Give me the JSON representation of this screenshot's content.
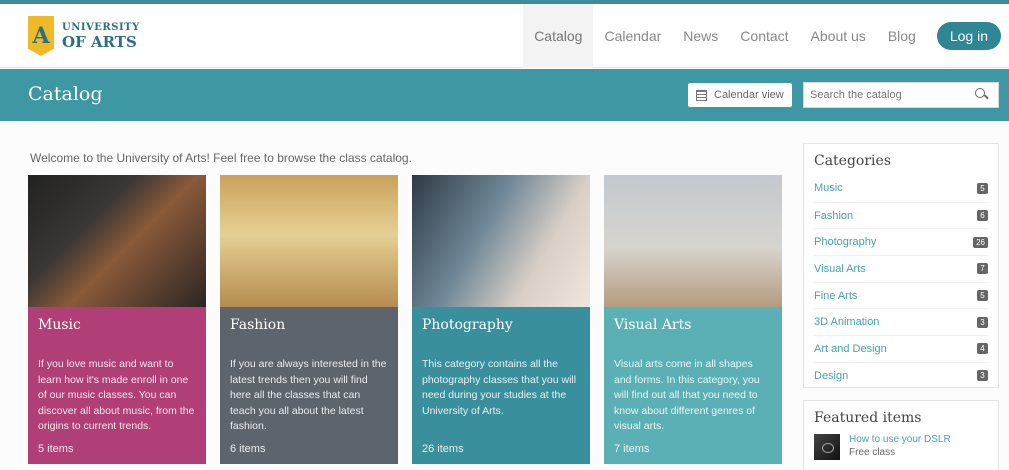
{
  "logo": {
    "letter": "A",
    "line1": "UNIVERSITY",
    "line2": "OF ARTS"
  },
  "nav": {
    "items": [
      "Catalog",
      "Calendar",
      "News",
      "Contact",
      "About us",
      "Blog"
    ],
    "login": "Log in"
  },
  "bar": {
    "title": "Catalog",
    "calendar_view": "Calendar view",
    "search_placeholder": "Search the catalog"
  },
  "welcome": "Welcome to the University of Arts! Feel free to browse the class catalog.",
  "cards": [
    {
      "title": "Music",
      "desc": "If you love music and want to learn how it's made enroll in one of our music classes. You can discover all about music, from the origins to current trends.",
      "count": "5 items",
      "color": "#b03f77"
    },
    {
      "title": "Fashion",
      "desc": "If you are always interested in the latest trends then you will find here all the classes that can teach you all about the latest fashion.",
      "count": "6 items",
      "color": "#5e646b"
    },
    {
      "title": "Photography",
      "desc": "This category contains all the photography classes that you will need during your studies at the University of Arts.",
      "count": "26 items",
      "color": "#3a8f9c"
    },
    {
      "title": "Visual Arts",
      "desc": "Visual arts come in all shapes and forms. In this category, you will find out all that you need to know about different genres of visual arts.",
      "count": "7 items",
      "color": "#5bb0b6"
    }
  ],
  "categories": {
    "title": "Categories",
    "items": [
      {
        "label": "Music",
        "count": "5"
      },
      {
        "label": "Fashion",
        "count": "6"
      },
      {
        "label": "Photography",
        "count": "26"
      },
      {
        "label": "Visual Arts",
        "count": "7"
      },
      {
        "label": "Fine Arts",
        "count": "5"
      },
      {
        "label": "3D Animation",
        "count": "3"
      },
      {
        "label": "Art and Design",
        "count": "4"
      },
      {
        "label": "Design",
        "count": "3"
      }
    ]
  },
  "featured": {
    "title": "Featured items",
    "item_link": "How to use your DSLR",
    "item_sub": "Free class"
  }
}
